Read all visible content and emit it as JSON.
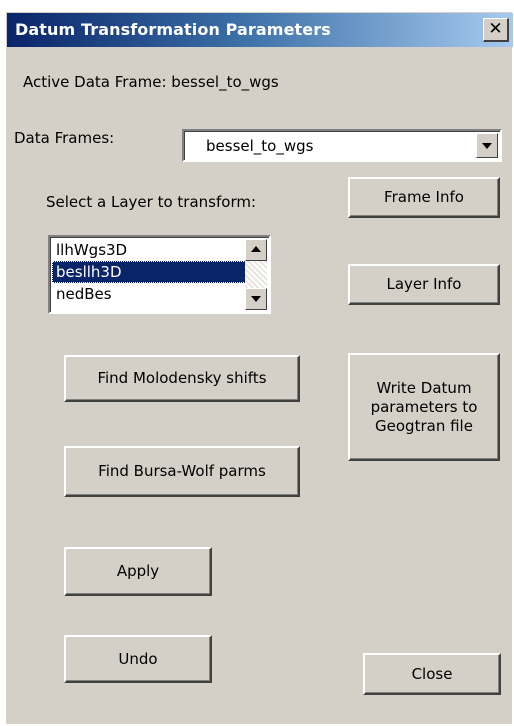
{
  "window": {
    "title": "Datum Transformation Parameters",
    "close_glyph": "✕"
  },
  "active_frame_label": "Active Data Frame: bessel_to_wgs",
  "data_frames": {
    "label": "Data Frames:",
    "selected": "bessel_to_wgs"
  },
  "layer_select": {
    "label": "Select a Layer to transform:",
    "items": [
      "llhWgs3D",
      "besllh3D",
      "nedBes"
    ],
    "selected_index": 1
  },
  "buttons": {
    "frame_info": "Frame Info",
    "layer_info": "Layer Info",
    "find_molodensky": "Find  Molodensky shifts",
    "write_datum": "Write Datum parameters to Geogtran file",
    "find_bursa_wolf": "Find Bursa-Wolf parms",
    "apply": "Apply",
    "undo": "Undo",
    "close": "Close"
  },
  "colors": {
    "titlebar_start": "#0a246a",
    "titlebar_end": "#a6caf0",
    "dialog_face": "#d4d0c8",
    "selection": "#0a246a"
  }
}
